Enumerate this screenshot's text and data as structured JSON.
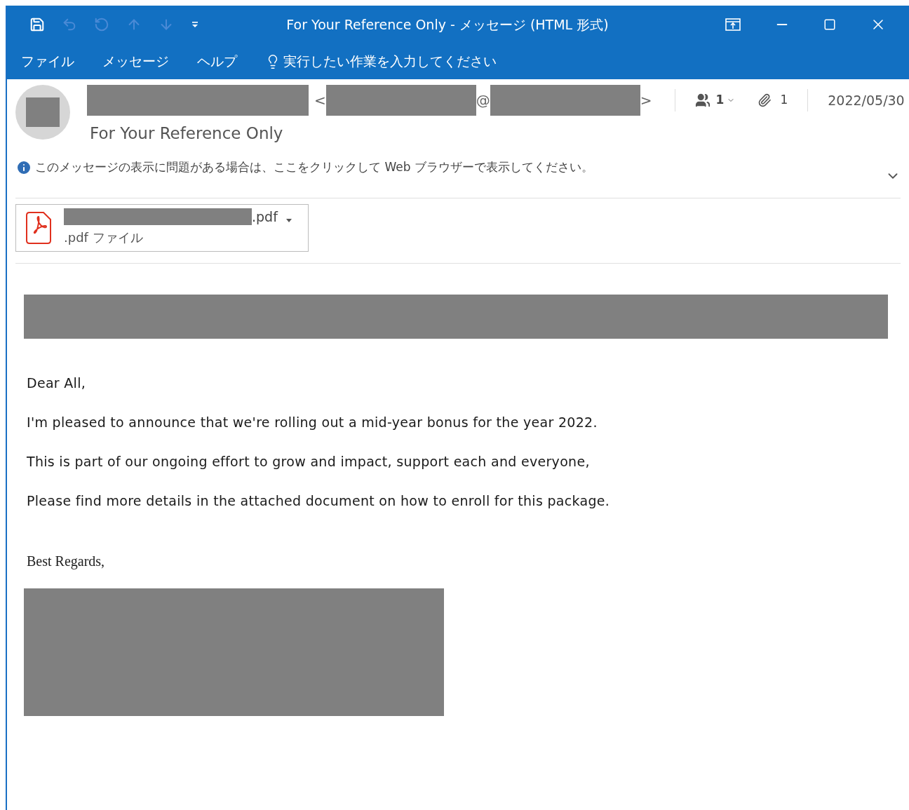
{
  "window": {
    "title": "For Your Reference Only  -  メッセージ (HTML 形式)"
  },
  "quick_access": [
    {
      "kind": "save",
      "disabled": false
    },
    {
      "kind": "undo",
      "disabled": true
    },
    {
      "kind": "redo",
      "disabled": true
    },
    {
      "kind": "up",
      "disabled": true
    },
    {
      "kind": "down",
      "disabled": true
    },
    {
      "kind": "customize",
      "disabled": false
    }
  ],
  "menu": [
    {
      "label": "ファイル"
    },
    {
      "label": "メッセージ"
    },
    {
      "label": "ヘルプ"
    }
  ],
  "tell_me": {
    "placeholder": "実行したい作業を入力してください"
  },
  "header": {
    "open_bracket": "<",
    "at_sign": "@",
    "close_bracket": ">",
    "recipients_count": "1",
    "attachments_count": "1",
    "date": "2022/05/30",
    "subject": "For Your Reference Only",
    "info_bar": "このメッセージの表示に問題がある場合は、ここをクリックして Web ブラウザーで表示してください。"
  },
  "attachment": {
    "name_suffix": ".pdf",
    "file_type": ".pdf ファイル"
  },
  "body": {
    "paragraphs": [
      "Dear All,",
      "I'm pleased to announce that we're rolling out a mid-year bonus for the year 2022.",
      "This is part of our ongoing effort to grow and impact, support each and everyone,",
      "Please find more details in the attached document on how to enroll for this package."
    ],
    "closing": "Best Regards,"
  }
}
